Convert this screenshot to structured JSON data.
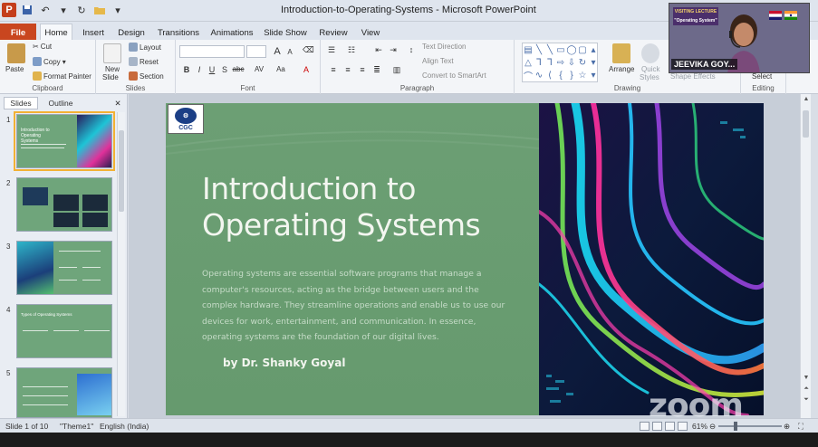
{
  "window": {
    "title": "Introduction-to-Operating-Systems - Microsoft PowerPoint",
    "app_icon_label": "P"
  },
  "tabs": [
    "File",
    "Home",
    "Insert",
    "Design",
    "Transitions",
    "Animations",
    "Slide Show",
    "Review",
    "View"
  ],
  "ribbon": {
    "clipboard": {
      "paste": "Paste",
      "cut": "Cut",
      "copy": "Copy",
      "format_painter": "Format Painter",
      "label": "Clipboard"
    },
    "slides": {
      "new_slide_line1": "New",
      "new_slide_line2": "Slide",
      "layout": "Layout",
      "reset": "Reset",
      "section": "Section",
      "label": "Slides"
    },
    "font": {
      "label": "Font",
      "bold": "B",
      "italic": "I",
      "underline": "U",
      "strike": "abc",
      "shadow": "S",
      "spacing": "AV",
      "case": "Aa",
      "color": "A",
      "grow": "A",
      "shrink": "A"
    },
    "paragraph": {
      "text_direction": "Text Direction",
      "align_text": "Align Text",
      "convert_smartart": "Convert to SmartArt",
      "label": "Paragraph"
    },
    "drawing": {
      "arrange": "Arrange",
      "quick_styles_line1": "Quick",
      "quick_styles_line2": "Styles",
      "shape_effects": "Shape Effects",
      "label": "Drawing"
    },
    "editing": {
      "select": "Select",
      "label": "Editing"
    }
  },
  "panel": {
    "tab_slides": "Slides",
    "tab_outline": "Outline",
    "thumbnails": [
      {
        "num": "1",
        "caption": "Introduction to Operating Systems"
      },
      {
        "num": "2",
        "caption": ""
      },
      {
        "num": "3",
        "caption": ""
      },
      {
        "num": "4",
        "caption": "Types of Operating Systems"
      },
      {
        "num": "5",
        "caption": ""
      }
    ]
  },
  "slide": {
    "logo_text": "CGC",
    "title_line1": "Introduction to",
    "title_line2": "Operating Systems",
    "body": "Operating systems are essential software programs that manage a computer's resources, acting as the bridge between users and the complex hardware. They streamline operations and enable us to use our devices for work, entertainment, and communication. In essence, operating systems are the foundation of our digital lives.",
    "author": "by Dr. Shanky Goyal"
  },
  "status": {
    "slide_info": "Slide 1 of 10",
    "theme": "\"Theme1\"",
    "language": "English (India)",
    "zoom": "61%"
  },
  "zoom_overlay": {
    "participant_name": "JEEVIKA GOY...",
    "banner_line1": "VISITING LECTURE",
    "banner_line2": "\"Operating System\"",
    "watermark": "zoom"
  },
  "colors": {
    "slide_green": "#6a9e72",
    "file_tab": "#c9461f",
    "selection": "#f2b134"
  }
}
